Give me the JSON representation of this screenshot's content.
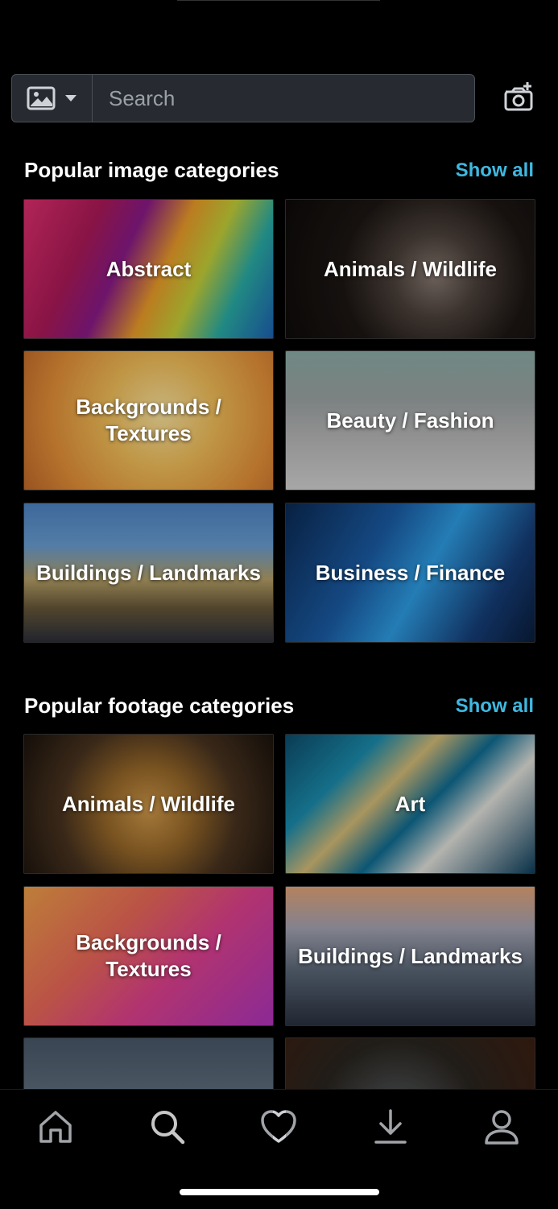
{
  "search": {
    "placeholder": "Search",
    "type_icon": "image-icon",
    "camera_icon": "camera-plus-icon"
  },
  "images_section": {
    "title": "Popular image categories",
    "show_all": "Show all",
    "tiles": [
      {
        "label": "Abstract"
      },
      {
        "label": "Animals / Wildlife"
      },
      {
        "label": "Backgrounds / Textures"
      },
      {
        "label": "Beauty / Fashion"
      },
      {
        "label": "Buildings / Landmarks"
      },
      {
        "label": "Business / Finance"
      }
    ]
  },
  "footage_section": {
    "title": "Popular footage categories",
    "show_all": "Show all",
    "tiles": [
      {
        "label": "Animals / Wildlife"
      },
      {
        "label": "Art"
      },
      {
        "label": "Backgrounds / Textures"
      },
      {
        "label": "Buildings / Landmarks"
      }
    ]
  },
  "bottom_nav": {
    "items": [
      {
        "icon": "home-icon"
      },
      {
        "icon": "search-icon"
      },
      {
        "icon": "heart-icon"
      },
      {
        "icon": "download-icon"
      },
      {
        "icon": "profile-icon"
      }
    ]
  },
  "colors": {
    "accent": "#3fb8e0",
    "background": "#000000",
    "searchbar": "#272b31"
  }
}
